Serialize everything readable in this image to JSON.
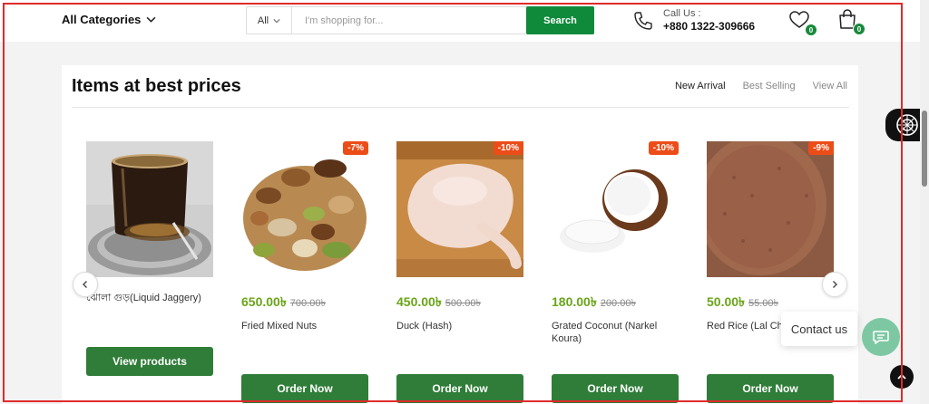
{
  "header": {
    "categories_label": "All Categories",
    "search_scope": "All",
    "search_placeholder": "I'm shopping for...",
    "search_button": "Search",
    "call_label": "Call Us :",
    "call_number": "+880 1322-309666",
    "wishlist_count": "0",
    "cart_count": "0"
  },
  "section": {
    "title": "Items at best prices",
    "tabs": [
      "New Arrival",
      "Best Selling",
      "View All"
    ]
  },
  "products": [
    {
      "name": "ঝোলা গুড়(Liquid Jaggery)",
      "button": "View products"
    },
    {
      "name": "Fried Mixed Nuts",
      "price": "650.00৳",
      "old_price": "700.00৳",
      "discount": "-7%",
      "button": "Order Now"
    },
    {
      "name": "Duck (Hash)",
      "price": "450.00৳",
      "old_price": "500.00৳",
      "discount": "-10%",
      "button": "Order Now"
    },
    {
      "name": "Grated Coconut (Narkel Koura)",
      "price": "180.00৳",
      "old_price": "200.00৳",
      "discount": "-10%",
      "button": "Order Now"
    },
    {
      "name": "Red Rice (Lal Ch",
      "price": "50.00৳",
      "old_price": "55.00৳",
      "discount": "-9%",
      "button": "Order Now"
    }
  ],
  "widgets": {
    "contact_label": "Contact us"
  },
  "colors": {
    "brand_green": "#0f8a3b",
    "button_green": "#2f7d38",
    "price_green": "#6aa519",
    "discount_orange": "#ec4d18"
  }
}
